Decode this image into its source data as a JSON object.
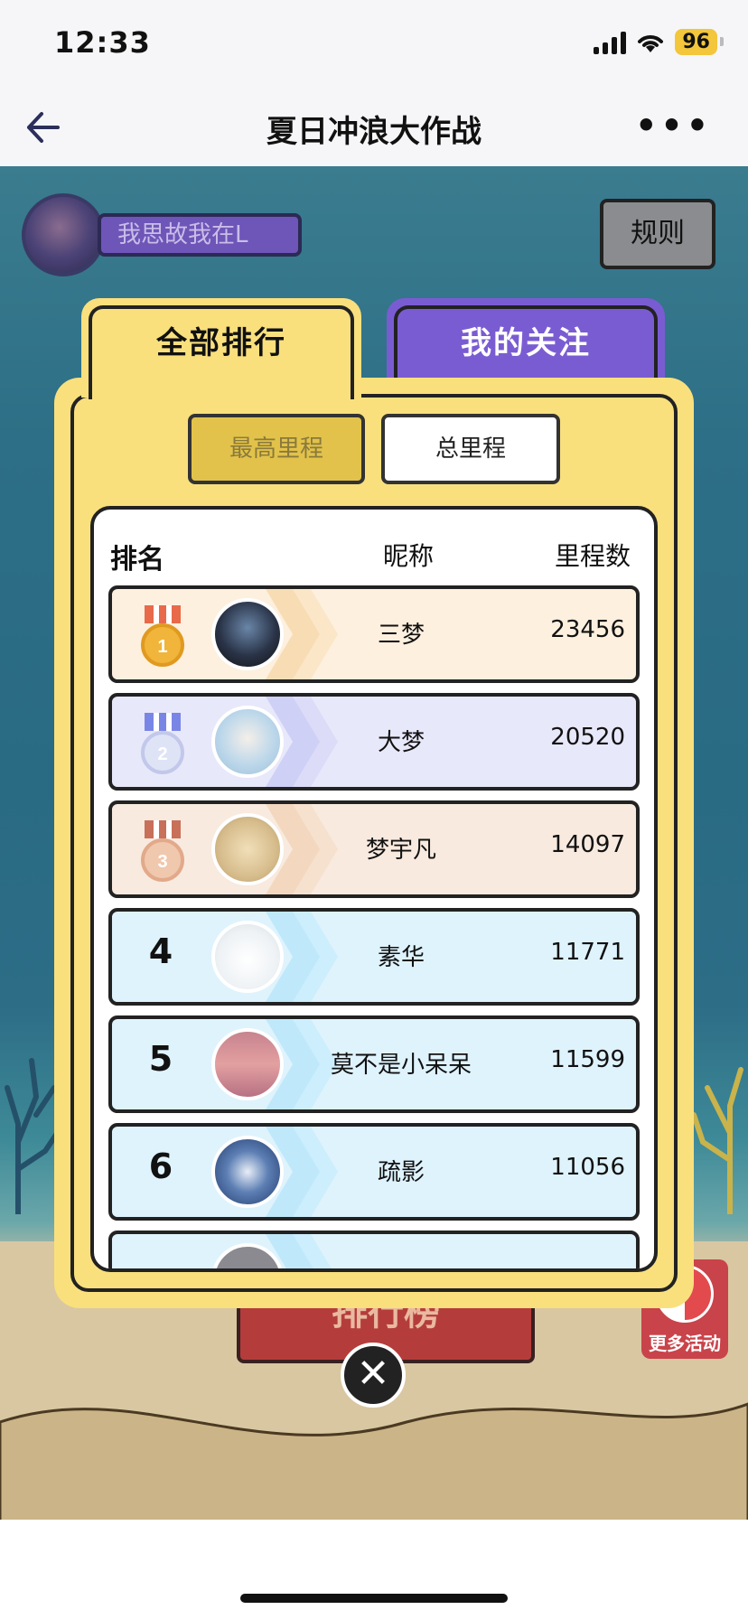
{
  "status": {
    "time": "12:33",
    "battery": "96"
  },
  "nav": {
    "title": "夏日冲浪大作战"
  },
  "user": {
    "name": "我思故我在L"
  },
  "rules_label": "规则",
  "tabs": {
    "all": "全部排行",
    "mine": "我的关注"
  },
  "segments": {
    "high": "最高里程",
    "total": "总里程"
  },
  "table": {
    "headers": {
      "rank": "排名",
      "name": "昵称",
      "distance": "里程数"
    },
    "rows": [
      {
        "rank": "1",
        "name": "三梦",
        "score": "23456"
      },
      {
        "rank": "2",
        "name": "大梦",
        "score": "20520"
      },
      {
        "rank": "3",
        "name": "梦宇凡",
        "score": "14097"
      },
      {
        "rank": "4",
        "name": "素华",
        "score": "11771"
      },
      {
        "rank": "5",
        "name": "莫不是小呆呆",
        "score": "11599"
      },
      {
        "rank": "6",
        "name": "疏影",
        "score": "11056"
      }
    ]
  },
  "banner": {
    "label": "排行榜"
  },
  "more_events": {
    "label": "更多活动"
  },
  "colors": {
    "gold_row": "#fdf0df",
    "silver_row": "#e8e8fb",
    "bronze_row": "#f8eadf",
    "blue_row": "#dff3fd",
    "panel": "#f9e07d",
    "tab_mine": "#7a5cd2"
  }
}
